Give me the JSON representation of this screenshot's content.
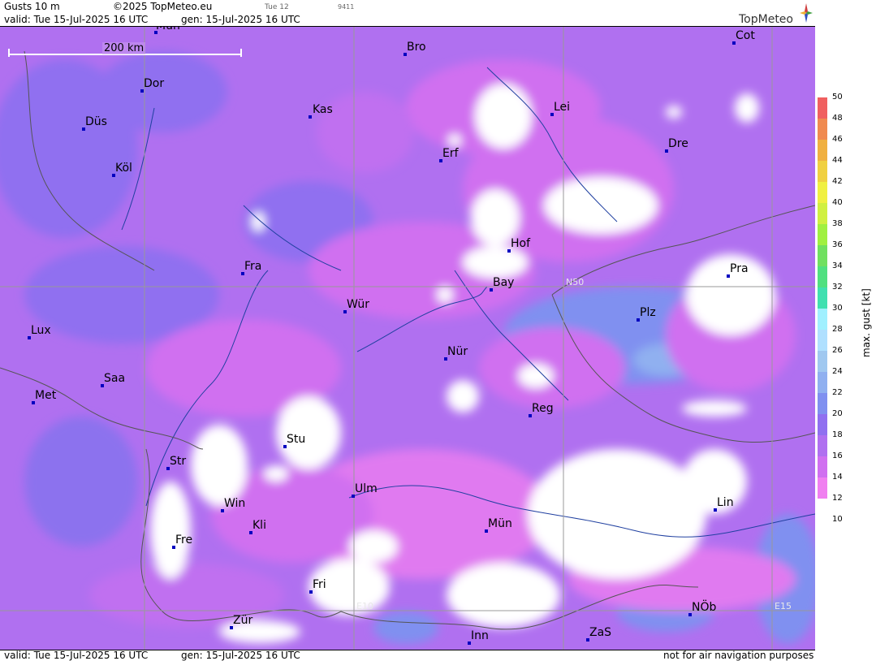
{
  "header": {
    "title": "Gusts 10 m",
    "copyright": "©2025 TopMeteo.eu",
    "day_tab": "Tue 12",
    "code": "9411",
    "valid": "valid:  Tue  15-Jul-2025  16 UTC",
    "gen": "gen: 15-Jul-2025 16 UTC",
    "logo": "TopMeteo"
  },
  "footer": {
    "valid": "valid:  Tue  15-Jul-2025  16 UTC",
    "gen": "gen: 15-Jul-2025 16 UTC",
    "note": "not for air navigation purposes"
  },
  "scale_bar": "200 km",
  "grid_labels": {
    "lat": "N50",
    "lon1": "E10",
    "lon2": "E15"
  },
  "cities": {
    "mun": "Mün",
    "bro": "Bro",
    "cot": "Cot",
    "dor": "Dor",
    "kas": "Kas",
    "lei": "Lei",
    "dus": "Düs",
    "erf": "Erf",
    "dre": "Dre",
    "kol": "Köl",
    "hof": "Hof",
    "fra": "Fra",
    "pra": "Pra",
    "bay": "Bay",
    "wur": "Wür",
    "plz": "Plz",
    "lux": "Lux",
    "nur": "Nür",
    "saa": "Saa",
    "met": "Met",
    "reg": "Reg",
    "stu": "Stu",
    "str": "Str",
    "ulm": "Ulm",
    "win": "Win",
    "lin": "Lin",
    "kli": "Kli",
    "mue": "Mün",
    "fre": "Fre",
    "fri": "Fri",
    "nob": "NÖb",
    "zur": "Zür",
    "zas": "ZaS",
    "inn": "Inn"
  },
  "legend": {
    "title": "max. gust [kt]",
    "ticks": [
      "50",
      "48",
      "46",
      "44",
      "42",
      "40",
      "38",
      "36",
      "34",
      "32",
      "30",
      "28",
      "26",
      "24",
      "22",
      "20",
      "18",
      "16",
      "14",
      "12",
      "10"
    ],
    "colors": [
      "#f06060",
      "#f08a50",
      "#f0b040",
      "#f0d040",
      "#f0f040",
      "#d0f040",
      "#a0f040",
      "#70e060",
      "#50e080",
      "#40e0b0",
      "#a0f0ff",
      "#b0e0ff",
      "#a0c8f0",
      "#90b0f0",
      "#8090f0",
      "#9070f0",
      "#b070f0",
      "#d070f0",
      "#f080f0",
      "#ffffff"
    ]
  }
}
